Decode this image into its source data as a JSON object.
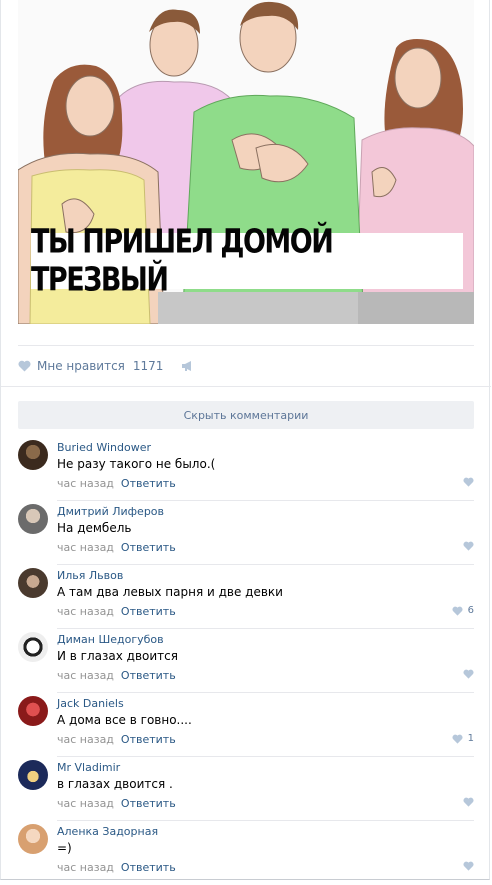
{
  "meme": {
    "caption": "ТЫ ПРИШЕЛ ДОМОЙ ТРЕЗВЫЙ"
  },
  "likes": {
    "label": "Мне нравится",
    "count": "1171"
  },
  "hide_comments": "Скрыть комментарии",
  "comments": [
    {
      "author": "Buried Windower",
      "text": "Не разу такого не было.(",
      "time": "час назад",
      "reply": "Ответить",
      "likes": ""
    },
    {
      "author": "Дмитрий Лиферов",
      "text": "На дембель",
      "time": "час назад",
      "reply": "Ответить",
      "likes": ""
    },
    {
      "author": "Илья Львов",
      "text": "А там два левых парня и две девки",
      "time": "час назад",
      "reply": "Ответить",
      "likes": "6"
    },
    {
      "author": "Диман Шедогубов",
      "text": "И в глазах двоится",
      "time": "час назад",
      "reply": "Ответить",
      "likes": ""
    },
    {
      "author": "Jack Daniels",
      "text": "А дома все в говно....",
      "time": "час назад",
      "reply": "Ответить",
      "likes": "1"
    },
    {
      "author": "Mr Vladimir",
      "text": "в глазах двоится .",
      "time": "час назад",
      "reply": "Ответить",
      "likes": ""
    },
    {
      "author": "Аленка Задорная",
      "text": "=)",
      "time": "час назад",
      "reply": "Ответить",
      "likes": ""
    }
  ],
  "colors": {
    "link": "#2a5885",
    "meta": "#939393",
    "like_icon": "#b6c7da",
    "button_bg": "#eef0f3"
  }
}
